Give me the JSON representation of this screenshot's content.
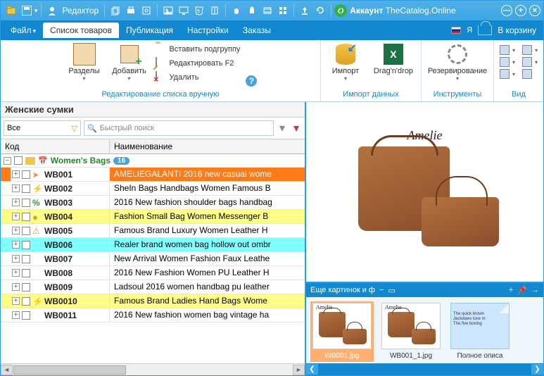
{
  "titlebar": {
    "editor": "Редактор",
    "account_label": "Аккаунт",
    "account_host": "TheCatalog.Online"
  },
  "menu": {
    "file": "Файл",
    "products": "Список товаров",
    "publish": "Публикация",
    "settings": "Настройки",
    "orders": "Заказы",
    "lang_char": "Я",
    "cart": "В корзину"
  },
  "ribbon": {
    "sections": "Разделы",
    "add": "Добавить",
    "insert_sub": "Вставить подгруппу",
    "edit_f2": "Редактировать F2",
    "delete": "Удалить",
    "group_edit": "Редактирование списка вручную",
    "import": "Импорт",
    "dragndrop": "Drag'n'drop",
    "group_import": "Импорт данных",
    "backup": "Резервирование",
    "group_tools": "Инструменты",
    "group_view": "Вид"
  },
  "leftpane_title": "Женские сумки",
  "filter": {
    "combo": "Все",
    "search_placeholder": "Быстрый поиск"
  },
  "columns": {
    "code": "Код",
    "name": "Наименование"
  },
  "group": {
    "name": "Women's Bags",
    "count": "16"
  },
  "rows": [
    {
      "code": "WB001",
      "name": "AMELIEGALANTI 2016 new casual wome",
      "cls": "row-sel",
      "ico": "ico-arrow"
    },
    {
      "code": "WB002",
      "name": "SheIn Bags Handbags Women Famous B",
      "cls": "",
      "ico": "ico-bolt"
    },
    {
      "code": "WB003",
      "name": "2016 New fashion shoulder bags handbag",
      "cls": "",
      "ico": "ico-pct"
    },
    {
      "code": "WB004",
      "name": "Fashion Small Bag Women Messenger B",
      "cls": "row-yellow",
      "ico": "ico-medal"
    },
    {
      "code": "WB005",
      "name": "Famous Brand Luxury Women Leather H",
      "cls": "",
      "ico": "ico-warn"
    },
    {
      "code": "WB006",
      "name": "Realer brand women bag hollow out ombr",
      "cls": "row-cyan",
      "ico": ""
    },
    {
      "code": "WB007",
      "name": "New Arrival Women Fashion Faux Leathe",
      "cls": "",
      "ico": ""
    },
    {
      "code": "WB008",
      "name": "2016 New Fashion Women PU Leather H",
      "cls": "",
      "ico": ""
    },
    {
      "code": "WB009",
      "name": "Ladsoul 2016 women handbag pu leather",
      "cls": "",
      "ico": ""
    },
    {
      "code": "WB0010",
      "name": "Famous Brand Ladies Hand Bags Wome",
      "cls": "row-yellow",
      "ico": "ico-bolt"
    },
    {
      "code": "WB0011",
      "name": "2016 New fashion women bag vintage ha",
      "cls": "",
      "ico": ""
    }
  ],
  "preview_brand": "Amelie",
  "thumb_header": "Еще картинок и ф",
  "thumbs": [
    {
      "label": "WB001.jpg",
      "sel": true,
      "type": "img"
    },
    {
      "label": "WB001_1.jpg",
      "sel": false,
      "type": "img"
    },
    {
      "label": "Полное описа",
      "sel": false,
      "type": "note"
    }
  ],
  "note_lines": [
    "The quick brown",
    "Jackdaws love m",
    "The five boxing"
  ]
}
